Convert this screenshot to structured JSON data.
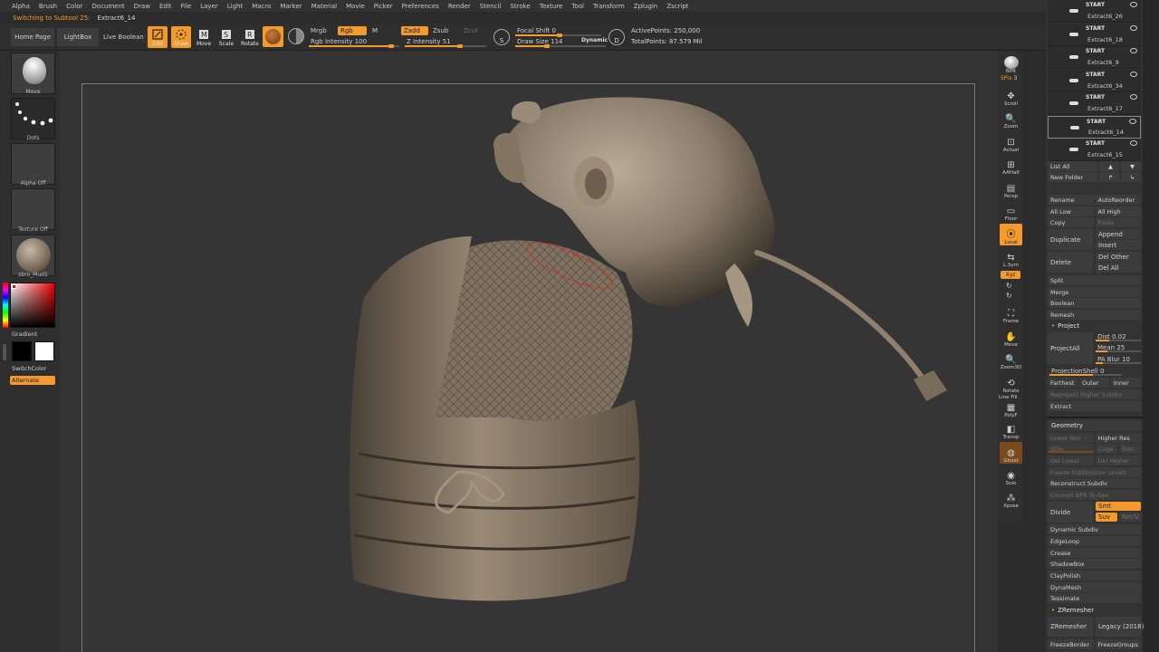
{
  "menu": [
    "Alpha",
    "Brush",
    "Color",
    "Document",
    "Draw",
    "Edit",
    "File",
    "Layer",
    "Light",
    "Macro",
    "Marker",
    "Material",
    "Movie",
    "Picker",
    "Preferences",
    "Render",
    "Stencil",
    "Stroke",
    "Texture",
    "Tool",
    "Transform",
    "Zplugin",
    "Zscript"
  ],
  "status": {
    "message": "Switching to Subtool 25:",
    "subtool": "Extract6_14"
  },
  "shelf": {
    "home": "Home Page",
    "lightbox": "LightBox",
    "liveboolean": "Live Boolean",
    "edit": "Edit",
    "draw": "Draw",
    "move": "Move",
    "scale": "Scale",
    "rotate": "Rotate",
    "mrgb": "Mrgb",
    "rgb": "Rgb",
    "m": "M",
    "zadd": "Zadd",
    "zsub": "Zsub",
    "zcut": "Zcut",
    "rgb_intensity_label": "Rgb Intensity",
    "rgb_intensity": 100,
    "z_intensity_label": "Z Intensity",
    "z_intensity": 51,
    "focal_label": "Focal Shift",
    "focal": 0,
    "drawsize_label": "Draw Size",
    "drawsize": 114,
    "dynamic": "Dynamic",
    "s_key": "S",
    "d_key": "D",
    "active_points": "ActivePoints: 250,000",
    "total_points": "TotalPoints: 87.579 Mil"
  },
  "left": {
    "move": "Move",
    "dots": "Dots",
    "alpha": "Alpha Off",
    "texture": "Texture Off",
    "material": "zbro_Mud1",
    "gradient": "Gradient",
    "switchcolor": "SwitchColor",
    "alternate": "Alternate"
  },
  "righttools": {
    "bpr": "BPR",
    "spix_label": "SPix",
    "spix": 3,
    "scroll": "Scroll",
    "zoom": "Zoom",
    "actual": "Actual",
    "aahalf": "AAHalf",
    "persp": "Persp",
    "floor": "Floor",
    "local": "Local",
    "lsym": "L.Sym",
    "xyz": "Xyz",
    "frame": "Frame",
    "move": "Move",
    "zoom3d": "Zoom3D",
    "rotate": "Rotate",
    "linefill": "Line Fill",
    "polyf": "PolyF",
    "transp": "Transp",
    "ghost": "Ghost",
    "solo": "Solo",
    "xpose": "Xpose"
  },
  "subtools": [
    {
      "start": "START",
      "name": "Extract6_26"
    },
    {
      "start": "START",
      "name": "Extract6_18"
    },
    {
      "start": "START",
      "name": "Extract6_9"
    },
    {
      "start": "START",
      "name": "Extract6_34"
    },
    {
      "start": "START",
      "name": "Extract6_17"
    },
    {
      "start": "START",
      "name": "Extract6_14"
    },
    {
      "start": "START",
      "name": "Extract6_15"
    }
  ],
  "subtool_panel": {
    "listall": "List All",
    "newfolder": "New Folder",
    "rename": "Rename",
    "autoreorder": "AutoReorder",
    "alllow": "All Low",
    "allhigh": "All High",
    "copy": "Copy",
    "paste": "Paste",
    "duplicate": "Duplicate",
    "append": "Append",
    "insert": "Insert",
    "delete": "Delete",
    "delother": "Del Other",
    "delall": "Del All",
    "split": "Split",
    "merge": "Merge",
    "boolean": "Boolean",
    "remesh": "Remesh",
    "project": "Project",
    "projectall": "ProjectAll",
    "dist_label": "Dist",
    "dist": "0.02",
    "mean_label": "Mean",
    "mean": "25",
    "pablur_label": "PA Blur",
    "pablur": "10",
    "projectionshell_label": "ProjectionShell",
    "projectionshell": "0",
    "farthest": "Farthest",
    "outer": "Outer",
    "inner": "Inner",
    "reproject": "Reproject Higher Subdiv",
    "extract": "Extract"
  },
  "geometry": {
    "title": "Geometry",
    "lowerres": "Lower Res",
    "higherres": "Higher Res",
    "sdiv": "SDiv",
    "cage": "Cage",
    "rstr": "Rstr",
    "dellower": "Del Lower",
    "delhigher": "Del Higher",
    "freeze": "Freeze SubDivision Levels",
    "reconstruct": "Reconstruct Subdiv",
    "convert": "Convert BPR To Geo",
    "divide": "Divide",
    "smt": "Smt",
    "suv": "Suv",
    "reuv": "ReUV",
    "dynamic": "Dynamic Subdiv",
    "edgeloop": "EdgeLoop",
    "crease": "Crease",
    "shadowbox": "ShadowBox",
    "claypolish": "ClayPolish",
    "dynamesh": "DynaMesh",
    "tessimate": "Tessimate",
    "zremesher_title": "ZRemesher",
    "zremesher": "ZRemesher",
    "legacy": "Legacy (2018)",
    "freezeborder": "FreezeBorder",
    "freezegroups": "FreezeGroups"
  },
  "colors": {
    "accent": "#f39a2e",
    "panel": "#333333",
    "clay": "#8f8172"
  }
}
